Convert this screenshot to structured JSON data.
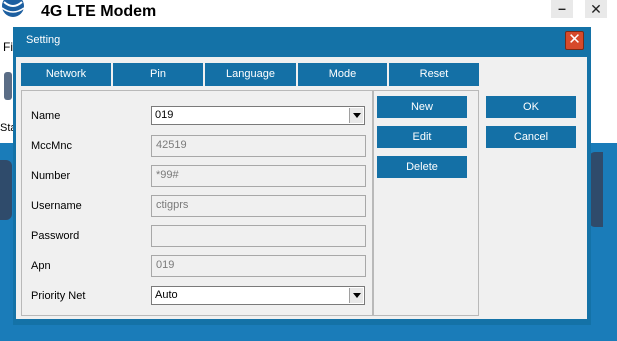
{
  "main_window": {
    "title": "4G LTE Modem",
    "minimize_glyph": "–",
    "close_glyph": "✕",
    "menu_partial": "Fi",
    "icon_label_partial": "Sta"
  },
  "dialog": {
    "title": "Setting",
    "close_glyph": "✕",
    "tabs": [
      {
        "label": "Network"
      },
      {
        "label": "Pin"
      },
      {
        "label": "Language"
      },
      {
        "label": "Mode"
      },
      {
        "label": "Reset"
      }
    ],
    "fields": {
      "name": {
        "label": "Name",
        "value": "019"
      },
      "mccmnc": {
        "label": "MccMnc",
        "value": "42519"
      },
      "number": {
        "label": "Number",
        "value": "*99#"
      },
      "username": {
        "label": "Username",
        "value": "ctigprs"
      },
      "password": {
        "label": "Password",
        "value": ""
      },
      "apn": {
        "label": "Apn",
        "value": "019"
      },
      "priority_net": {
        "label": "Priority Net",
        "value": "Auto"
      }
    },
    "profile_buttons": {
      "new": "New",
      "edit": "Edit",
      "delete": "Delete"
    },
    "ok_label": "OK",
    "cancel_label": "Cancel"
  },
  "colors": {
    "accent": "#1470a6",
    "background_blue": "#1a7cb9",
    "close_red": "#d64a2b"
  }
}
